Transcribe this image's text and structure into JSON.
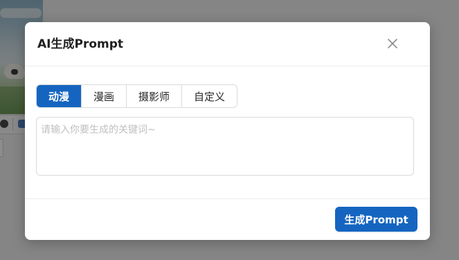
{
  "dialog": {
    "title": "AI生成Prompt",
    "close_icon": "close-icon",
    "tabs": [
      {
        "label": "动漫",
        "active": true
      },
      {
        "label": "漫画",
        "active": false
      },
      {
        "label": "摄影师",
        "active": false
      },
      {
        "label": "自定义",
        "active": false
      }
    ],
    "textarea": {
      "placeholder": "请输入你要生成的关键词~",
      "value": ""
    },
    "generate_button_label": "生成Prompt"
  },
  "colors": {
    "primary": "#1565c0",
    "overlay": "rgba(0,0,0,0.45)"
  }
}
